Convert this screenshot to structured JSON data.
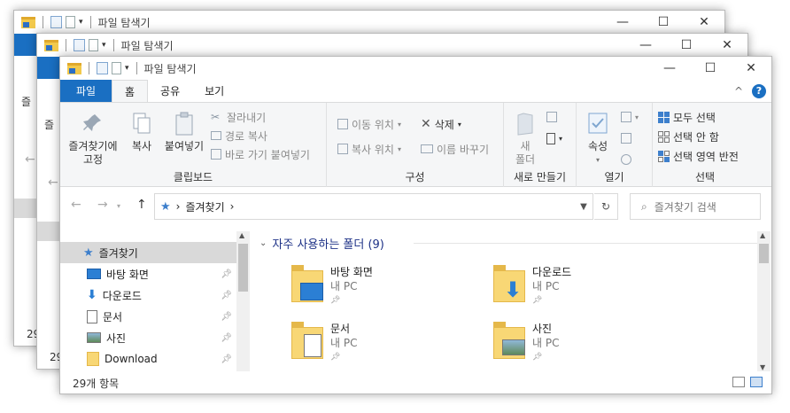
{
  "app": {
    "title": "파일 탐색기"
  },
  "window_controls": {
    "minimize": "—",
    "maximize": "☐",
    "close": "✕"
  },
  "tabs": [
    {
      "label": "파일"
    },
    {
      "label": "홈"
    },
    {
      "label": "공유"
    },
    {
      "label": "보기"
    }
  ],
  "ribbon_right": {
    "collapse": "^",
    "help": "?"
  },
  "ribbon": {
    "clipboard": {
      "pin_quick": "즐겨찾기에",
      "pin_quick2": "고정",
      "copy": "복사",
      "paste": "붙여넣기",
      "cut": "잘라내기",
      "copy_path": "경로 복사",
      "paste_shortcut": "바로 가기 붙여넣기",
      "label": "클립보드"
    },
    "organize": {
      "move_to": "이동 위치",
      "copy_to": "복사 위치",
      "delete": "삭제",
      "rename": "이름 바꾸기",
      "label": "구성"
    },
    "new": {
      "new_folder1": "새",
      "new_folder2": "폴더",
      "label": "새로 만들기"
    },
    "open": {
      "properties": "속성",
      "label": "열기"
    },
    "select": {
      "select_all": "모두 선택",
      "select_none": "선택 안 함",
      "invert": "선택 영역 반전",
      "label": "선택"
    }
  },
  "address": {
    "back": "←",
    "forward": "→",
    "up": "↑",
    "path_root": "즐겨찾기",
    "separator": "›",
    "refresh": "↻",
    "search_placeholder": "즐겨찾기 검색"
  },
  "nav": [
    {
      "label": "즐겨찾기",
      "selected": true
    },
    {
      "label": "바탕 화면",
      "pinned": true
    },
    {
      "label": "다운로드",
      "pinned": true
    },
    {
      "label": "문서",
      "pinned": true
    },
    {
      "label": "사진",
      "pinned": true
    },
    {
      "label": "Download",
      "pinned": true
    }
  ],
  "main": {
    "section_title": "자주 사용하는 폴더 (9)",
    "tiles": [
      {
        "name": "바탕 화면",
        "location": "내 PC"
      },
      {
        "name": "다운로드",
        "location": "내 PC"
      },
      {
        "name": "문서",
        "location": "내 PC"
      },
      {
        "name": "사진",
        "location": "내 PC"
      }
    ]
  },
  "status": {
    "count": "29개 항목"
  },
  "behind": {
    "peek1": "즐",
    "peek2": "즐",
    "count1": "29",
    "count2": "29"
  },
  "colors": {
    "file_tab": "#1a6fc2",
    "selection": "#d9d9d9",
    "section_title": "#1e3287"
  }
}
